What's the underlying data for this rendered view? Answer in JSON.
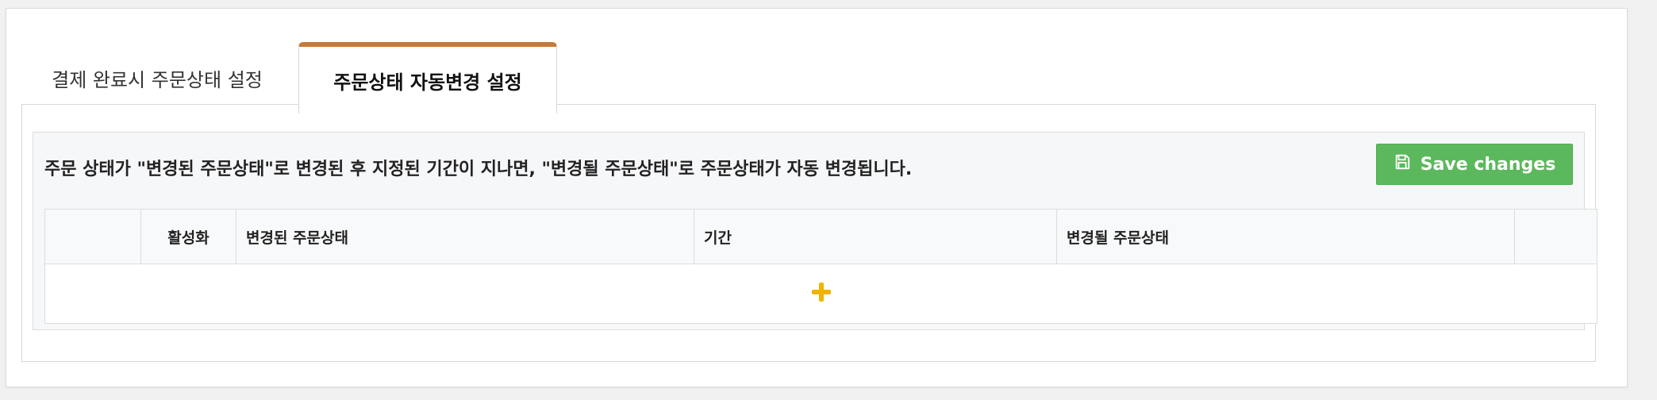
{
  "tabs": [
    {
      "label": "결제 완료시 주문상태 설정",
      "active": false
    },
    {
      "label": "주문상태 자동변경 설정",
      "active": true
    }
  ],
  "panel": {
    "notice": "주문 상태가 \"변경된 주문상태\"로 변경된 후 지정된 기간이 지나면, \"변경될 주문상태\"로 주문상태가 자동 변경됩니다.",
    "save_button": {
      "label": "Save changes",
      "icon": "save-icon",
      "color": "#5cb85c"
    }
  },
  "table": {
    "columns": [
      "",
      "활성화",
      "변경된 주문상태",
      "기간",
      "변경될 주문상태",
      ""
    ],
    "add_row_icon": "plus-icon",
    "add_icon_color": "#f0b400"
  },
  "colors": {
    "active_tab_accent": "#c47a37"
  }
}
